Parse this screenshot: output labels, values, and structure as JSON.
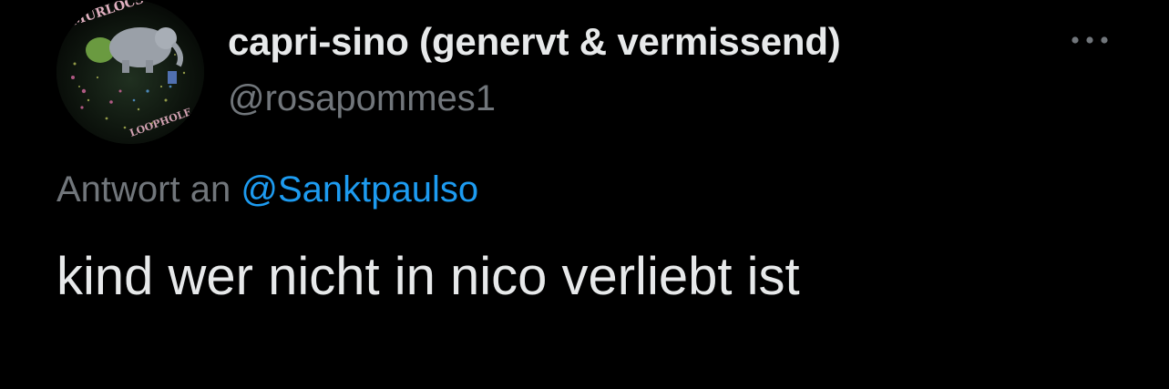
{
  "author": {
    "display_name": "capri-sino (genervt & vermissend)",
    "handle": "@rosapommes1",
    "avatar_icon": "profile-avatar-image"
  },
  "more_icon": "ellipsis-icon",
  "reply": {
    "prefix": "Antwort an",
    "mention": "@Sanktpaulso"
  },
  "tweet": {
    "text": "kind wer nicht in nico verliebt ist"
  },
  "colors": {
    "background": "#000000",
    "primary_text": "#e7e9ea",
    "secondary_text": "#71767b",
    "link": "#1d9bf0"
  }
}
